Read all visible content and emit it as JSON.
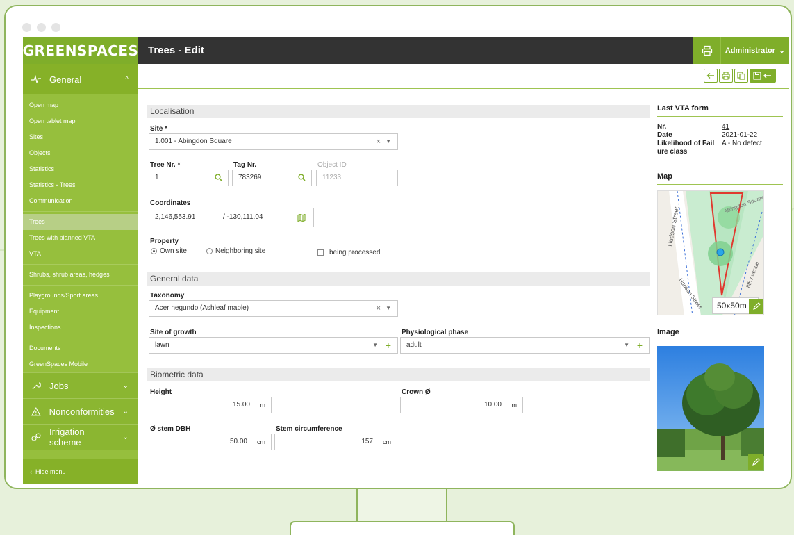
{
  "app": {
    "logo": "GREENSPACES",
    "page_title": "Trees - Edit",
    "user": "Administrator",
    "hide_menu": "Hide menu"
  },
  "sidebar": {
    "general_label": "General",
    "items": [
      {
        "label": "Open map"
      },
      {
        "label": "Open tablet map"
      },
      {
        "label": "Sites"
      },
      {
        "label": "Objects"
      },
      {
        "label": "Statistics"
      },
      {
        "label": "Statistics - Trees"
      },
      {
        "label": "Communication"
      },
      {
        "label": "Trees",
        "active": true
      },
      {
        "label": "Trees with planned VTA"
      },
      {
        "label": "VTA"
      },
      {
        "label": "Shrubs, shrub areas, hedges"
      },
      {
        "label": "Playgrounds/Sport areas"
      },
      {
        "label": "Equipment"
      },
      {
        "label": "Inspections"
      },
      {
        "label": "Documents"
      },
      {
        "label": "GreenSpaces Mobile"
      }
    ],
    "groups": [
      {
        "label": "Jobs"
      },
      {
        "label": "Nonconformities"
      },
      {
        "label": "Irrigation scheme"
      }
    ]
  },
  "form": {
    "localisation": "Localisation",
    "site_label": "Site *",
    "site_value": "1.001 - Abingdon Square",
    "tree_nr_label": "Tree Nr. *",
    "tree_nr_value": "1",
    "tag_nr_label": "Tag Nr.",
    "tag_nr_value": "783269",
    "object_id_label": "Object ID",
    "object_id_value": "11233",
    "coordinates_label": "Coordinates",
    "coord_x": "2,146,553.91",
    "coord_y": "/ -130,111.04",
    "property_label": "Property",
    "own_site": "Own site",
    "neighboring_site": "Neighboring site",
    "being_processed": "being processed",
    "general_data": "General data",
    "taxonomy_label": "Taxonomy",
    "taxonomy_value": "Acer negundo (Ashleaf maple)",
    "site_growth_label": "Site of growth",
    "site_growth_value": "lawn",
    "phys_phase_label": "Physiological phase",
    "phys_phase_value": "adult",
    "biometric": "Biometric data",
    "height_label": "Height",
    "height_value": "15.00",
    "height_unit": "m",
    "crown_label": "Crown Ø",
    "crown_value": "10.00",
    "crown_unit": "m",
    "dbh_label": "Ø stem DBH",
    "dbh_value": "50.00",
    "dbh_unit": "cm",
    "circ_label": "Stem circumference",
    "circ_value": "157",
    "circ_unit": "cm"
  },
  "vta": {
    "title": "Last VTA form",
    "nr_label": "Nr.",
    "nr_value": "41",
    "date_label": "Date",
    "date_value": "2021-01-22",
    "fail_label_1": "Likelihood of Fail",
    "fail_label_2": "ure class",
    "fail_value": "A - No defect"
  },
  "map": {
    "title": "Map",
    "zoom": "50x50m",
    "street_1": "Hudson Street",
    "street_2": "Hudson Street",
    "street_3": "8th Avenue",
    "square": "Abingdon Square"
  },
  "image": {
    "title": "Image"
  },
  "colors": {
    "brand": "#7fae2a",
    "dark": "#333333"
  }
}
